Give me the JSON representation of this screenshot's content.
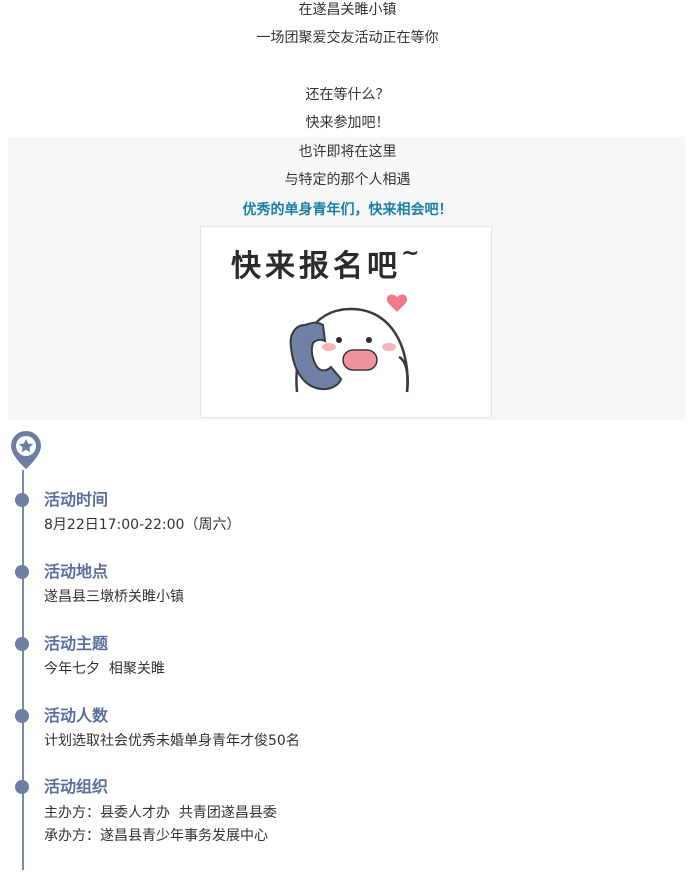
{
  "intro": {
    "lines": [
      "在遂昌关睢小镇",
      "一场团聚爱交友活动正在等你",
      "还在等什么？",
      "快来参加吧！",
      "也许即将在这里",
      "与特定的那个人相遇"
    ],
    "highlight": "优秀的单身青年们，快来相会吧！"
  },
  "sticker": {
    "title": "快来报名吧",
    "tilde": "~"
  },
  "timeline": {
    "items": [
      {
        "title": "活动时间",
        "lines": [
          "8月22日17:00-22:00（周六）"
        ]
      },
      {
        "title": "活动地点",
        "lines": [
          "遂昌县三墩桥关睢小镇"
        ]
      },
      {
        "title": "活动主题",
        "lines": [
          "今年七夕  相聚关睢"
        ]
      },
      {
        "title": "活动人数",
        "lines": [
          "计划选取社会优秀未婚单身青年才俊50名"
        ]
      },
      {
        "title": "活动组织",
        "lines": [
          "主办方：县委人才办  共青团遂昌县委",
          "承办方：遂昌县青少年事务发展中心"
        ]
      }
    ]
  },
  "colors": {
    "accent": "#5a6f9c",
    "highlight": "#1a7fa8",
    "panel": "#f7f7f7"
  }
}
